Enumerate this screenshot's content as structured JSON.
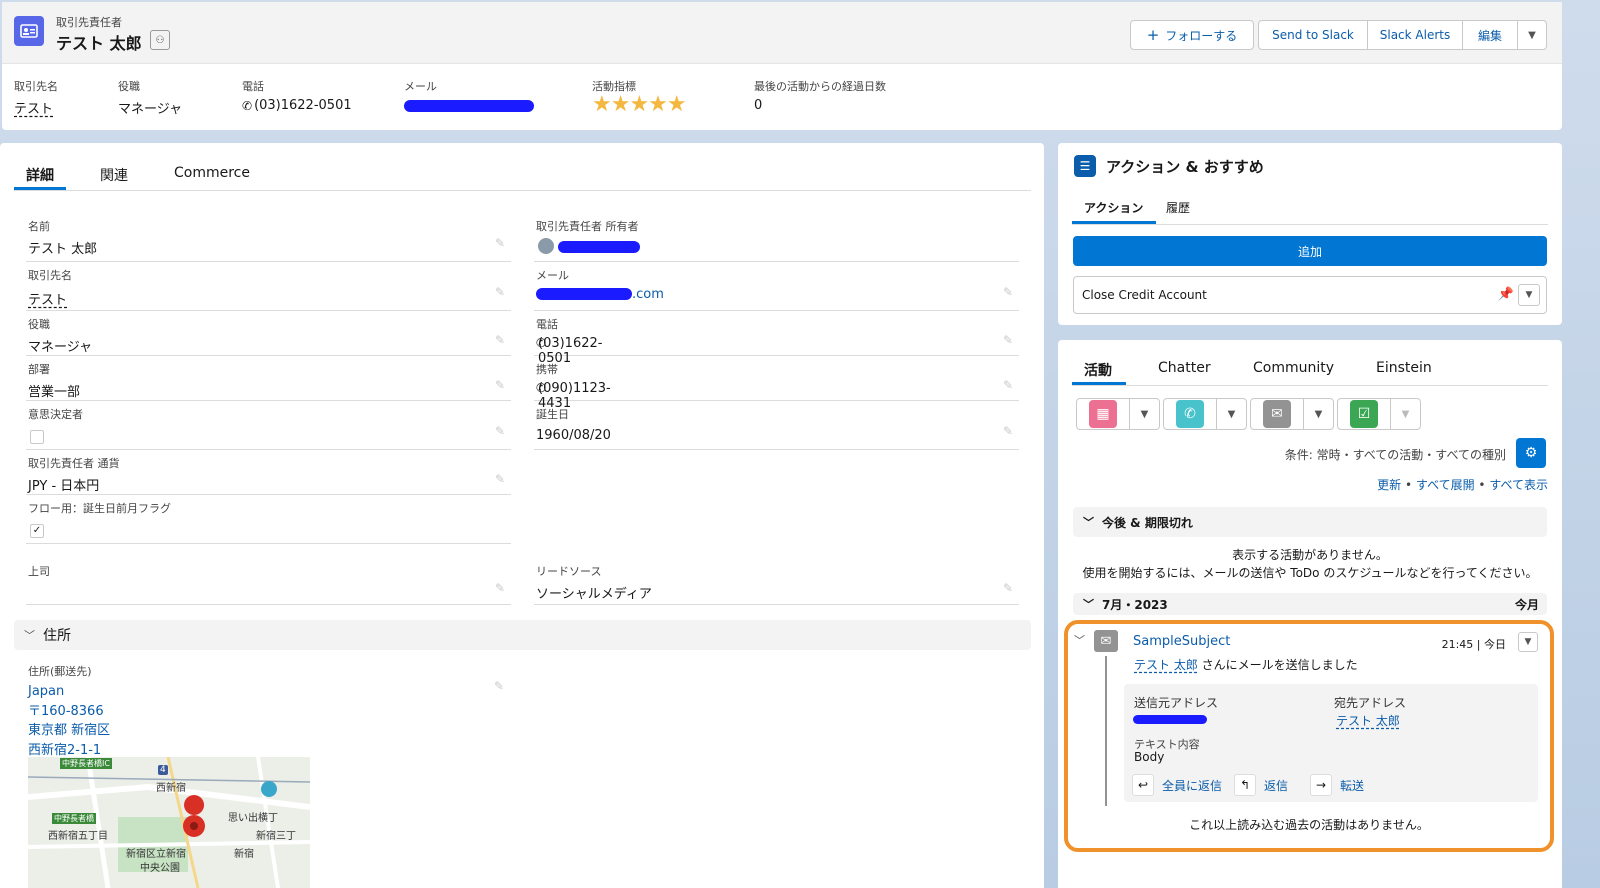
{
  "header": {
    "object_label": "取引先責任者",
    "record_name": "テスト 太郎",
    "follow_label": "フォローする",
    "send_slack_label": "Send to Slack",
    "slack_alerts_label": "Slack Alerts",
    "edit_label": "編集"
  },
  "highlights": [
    {
      "label": "取引先名",
      "value": "テスト"
    },
    {
      "label": "役職",
      "value": "マネージャ"
    },
    {
      "label": "電話",
      "value": "(03)1622-0501"
    },
    {
      "label": "メール",
      "value": ""
    },
    {
      "label": "活動指標",
      "value": "★★★★★"
    },
    {
      "label": "最後の活動からの経過日数",
      "value": "0"
    }
  ],
  "tabs": {
    "detail": "詳細",
    "related": "関連",
    "commerce": "Commerce"
  },
  "fields": {
    "name": {
      "label": "名前",
      "value": "テスト 太郎"
    },
    "owner": {
      "label": "取引先責任者 所有者"
    },
    "account": {
      "label": "取引先名",
      "value": "テスト"
    },
    "email": {
      "label": "メール",
      "value_suffix": ".com"
    },
    "title": {
      "label": "役職",
      "value": "マネージャ"
    },
    "phone": {
      "label": "電話",
      "value": "(03)1622-0501"
    },
    "dept": {
      "label": "部署",
      "value": "営業一部"
    },
    "mobile": {
      "label": "携帯",
      "value": "(090)1123-4431"
    },
    "decision": {
      "label": "意思決定者"
    },
    "birthday": {
      "label": "誕生日",
      "value": "1960/08/20"
    },
    "currency": {
      "label": "取引先責任者 通貨",
      "value": "JPY - 日本円"
    },
    "flow_flag": {
      "label": "フロー用：誕生日前月フラグ"
    },
    "boss": {
      "label": "上司"
    },
    "lead_source": {
      "label": "リードソース",
      "value": "ソーシャルメディア"
    }
  },
  "address": {
    "section": "住所",
    "label": "住所(郵送先)",
    "lines": [
      "Japan",
      "〒160-8366",
      "東京都 新宿区",
      "西新宿2-1-1"
    ],
    "map_labels": [
      "中野長者橋IC",
      "西新宿",
      "中野長者橋",
      "西新宿五丁目",
      "思い出横丁",
      "新宿三丁",
      "新宿区立新宿",
      "中央公園",
      "新宿",
      "4"
    ]
  },
  "actions": {
    "title": "アクション & おすすめ",
    "tab_actions": "アクション",
    "tab_history": "履歴",
    "add_label": "追加",
    "item": "Close Credit Account"
  },
  "activity": {
    "tabs": [
      "活動",
      "Chatter",
      "Community",
      "Einstein"
    ],
    "filter": "条件: 常時・すべての活動・すべての種別",
    "links": [
      "更新",
      "すべて展開",
      "すべて表示"
    ],
    "upcoming_title": "今後 & 期限切れ",
    "empty_line1": "表示する活動がありません。",
    "empty_line2": "使用を開始するには、メールの送信や ToDo のスケジュールなどを行ってください。",
    "month": "7月・2023",
    "month_right": "今月",
    "email": {
      "subject": "SampleSubject",
      "time": "21:45 | 今日",
      "sender": "テスト 太郎",
      "sent_text": "さんにメールを送信しました",
      "from_label": "送信元アドレス",
      "to_label": "宛先アドレス",
      "to_value": "テスト 太郎",
      "body_label": "テキスト内容",
      "body_value": "Body",
      "reply_all": "全員に返信",
      "reply": "返信",
      "forward": "転送"
    },
    "no_more": "これ以上読み込む過去の活動はありません。"
  },
  "colors": {
    "accent": "#0176d3",
    "highlight_border": "#f0922b"
  }
}
